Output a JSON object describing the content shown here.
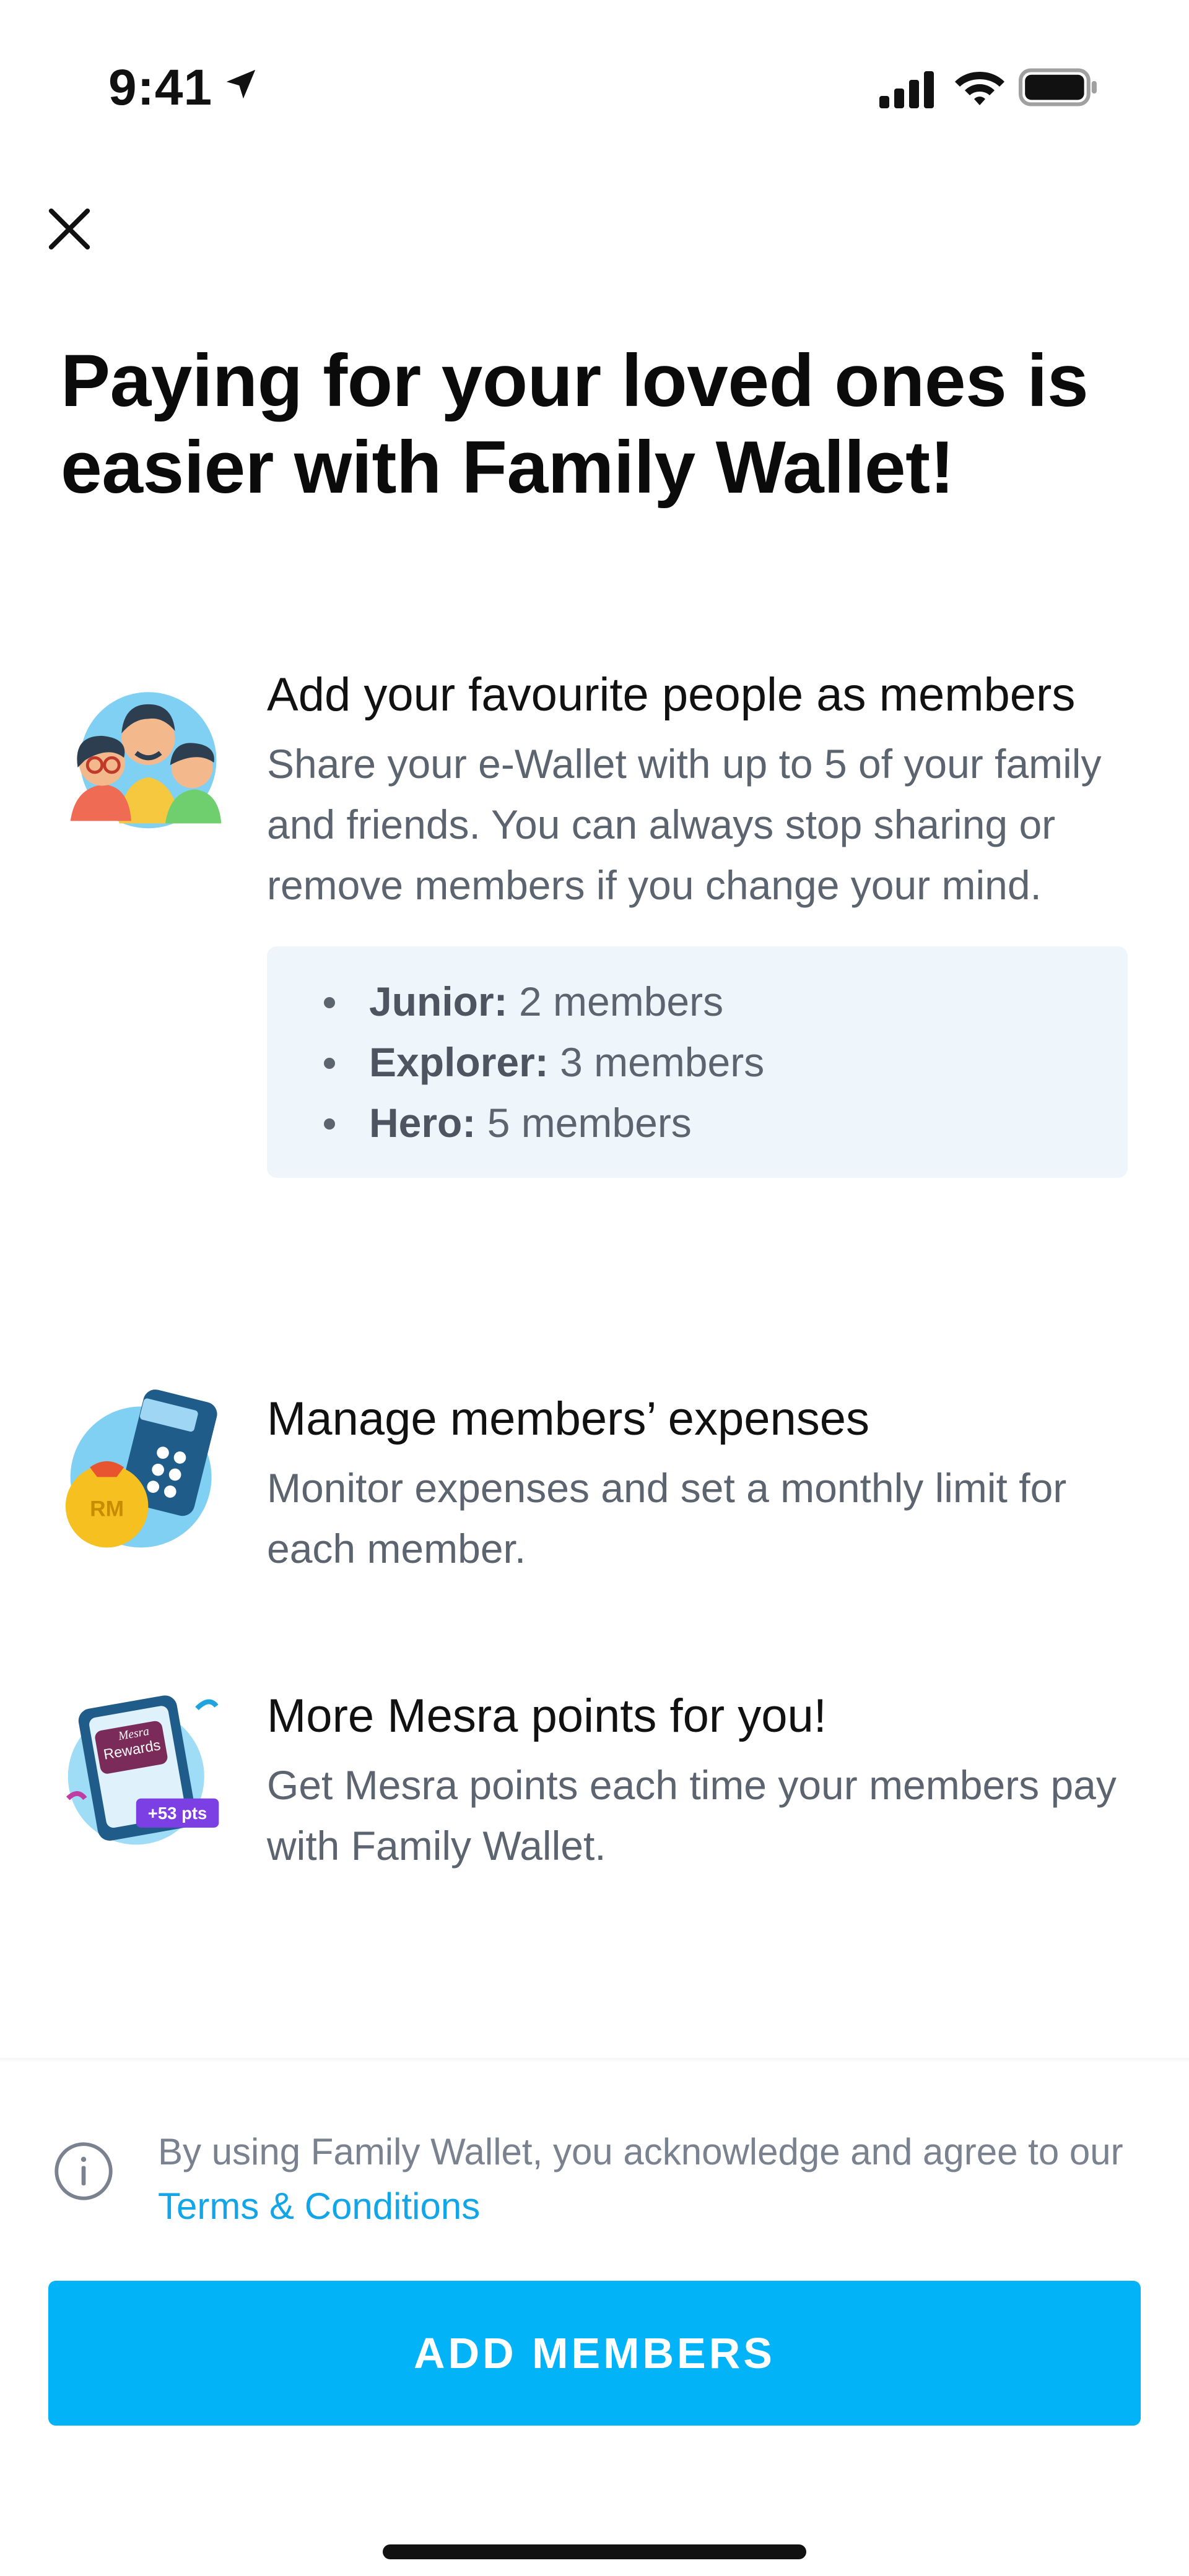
{
  "status_bar": {
    "time": "9:41",
    "icons": [
      "location-arrow-icon",
      "cellular-signal-icon",
      "wifi-icon",
      "battery-icon"
    ]
  },
  "header": {
    "close_icon": "close-icon",
    "title": "Paying for your loved ones is easier with Family Wallet!"
  },
  "features": [
    {
      "icon": "family-illustration-icon",
      "title": "Add your favourite people as members",
      "description": "Share your e-Wallet with up to 5 of your family and friends. You can always stop sharing or remove members if you change your mind.",
      "tiers": [
        {
          "name": "Junior:",
          "value": "2 members"
        },
        {
          "name": "Explorer:",
          "value": "3 members"
        },
        {
          "name": "Hero:",
          "value": "5 members"
        }
      ]
    },
    {
      "icon": "expenses-calculator-illustration-icon",
      "title": "Manage members’ expenses",
      "description": "Monitor expenses and set a monthly limit for each member.",
      "badge": "RM"
    },
    {
      "icon": "mesra-rewards-illustration-icon",
      "title": "More Mesra points for you!",
      "description": "Get Mesra points each time your members pay with Family Wallet.",
      "card_brand": "Mesra",
      "card_label": "Rewards",
      "points_badge": "+53 pts"
    }
  ],
  "footer": {
    "consent_text": "By using Family Wallet, you acknowledge and agree to our",
    "terms_link": "Terms & Conditions",
    "primary_button": "ADD MEMBERS"
  },
  "colors": {
    "primary": "#03b3f7",
    "link": "#12a6e8",
    "tier_box_bg": "#eef6fc",
    "body_text": "#5c6470"
  }
}
